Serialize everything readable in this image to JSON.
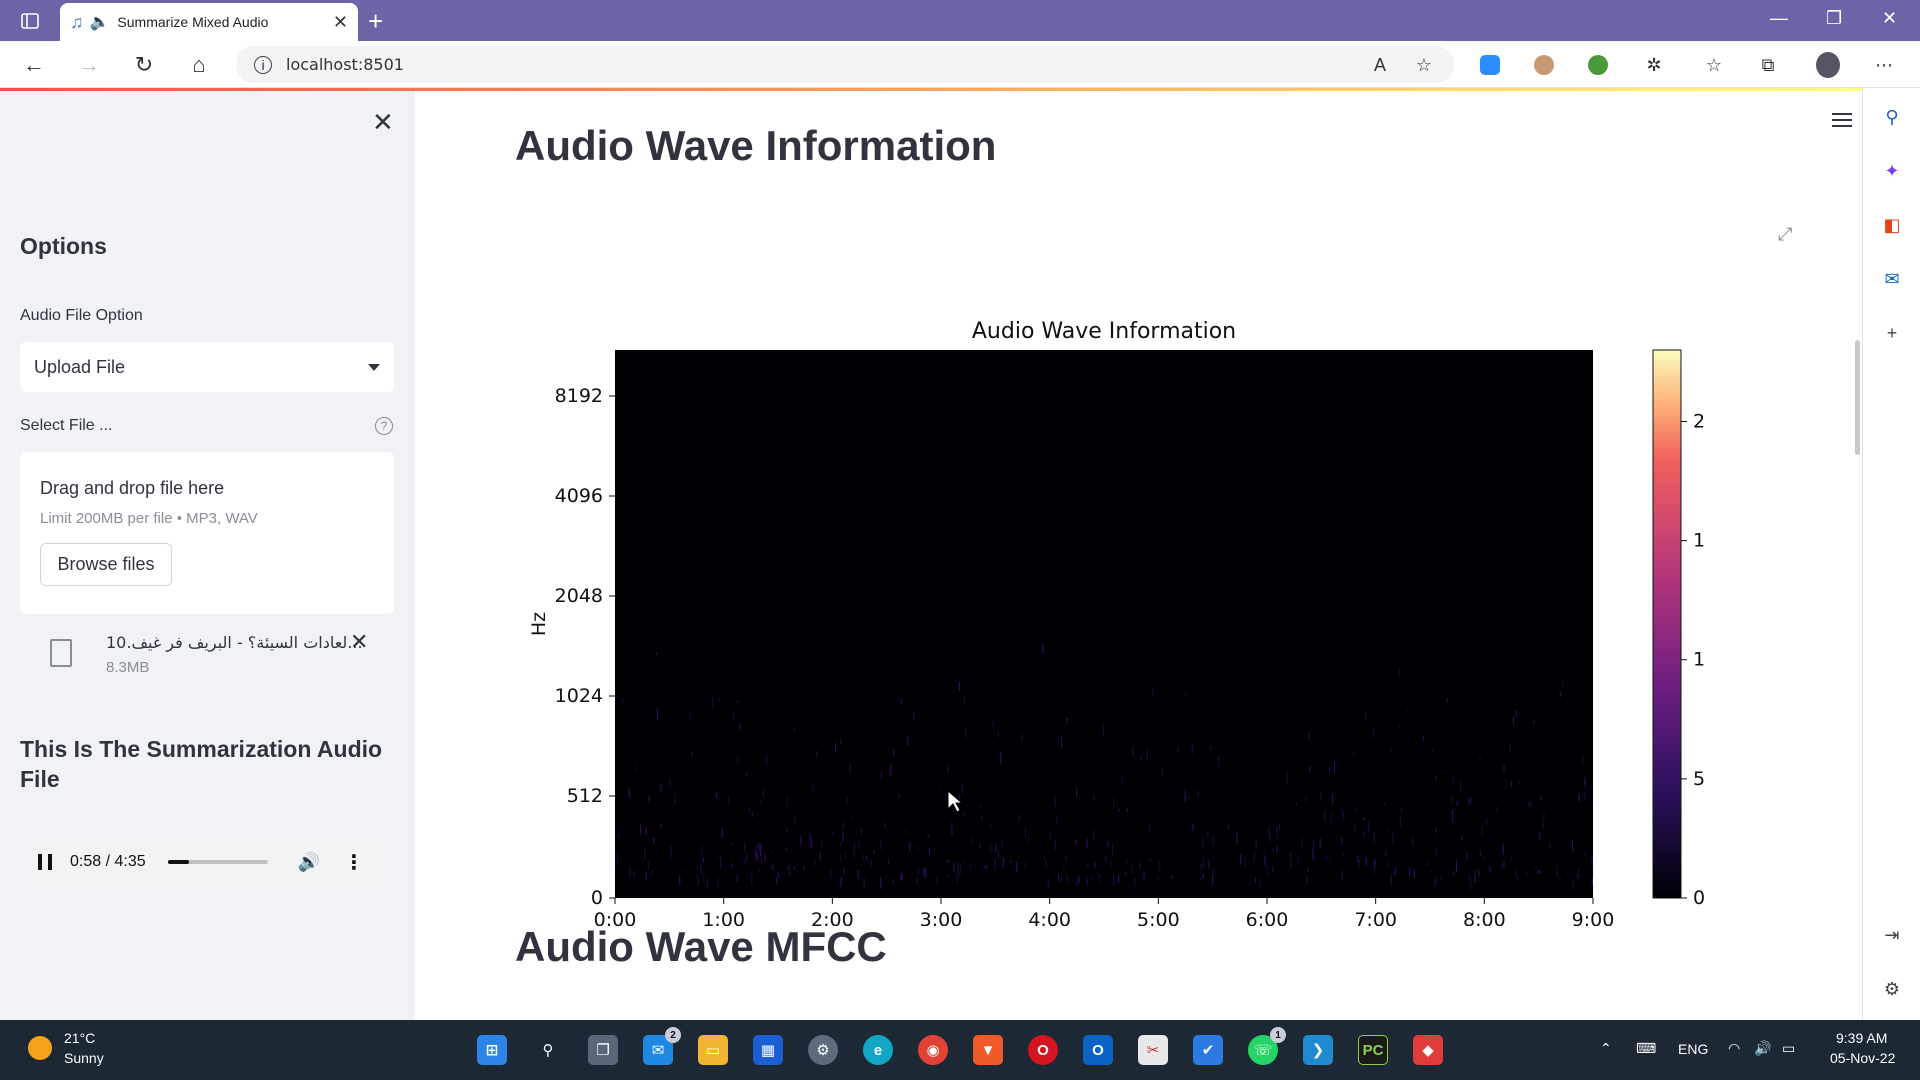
{
  "browser": {
    "tab_title": "Summarize Mixed Audio",
    "url": "localhost:8501"
  },
  "sidebar": {
    "heading": "Options",
    "audio_option_label": "Audio File Option",
    "audio_option_value": "Upload File",
    "select_file_label": "Select File ...",
    "dropzone_title": "Drag and drop file here",
    "dropzone_limit": "Limit 200MB per file • MP3, WAV",
    "browse_label": "Browse files",
    "file_name": "10.لعادات السيئة؟ - البريف فر غيف...",
    "file_size": "8.3MB",
    "summary_heading": "This Is The Summarization Audio File",
    "player_time": "0:58 / 4:35",
    "player_progress": 0.21
  },
  "main": {
    "heading_top": "Audio Wave Information",
    "heading_bottom": "Audio Wave MFCC"
  },
  "chart_data": {
    "type": "heatmap",
    "title": "Audio Wave Information",
    "xlabel": "Time",
    "ylabel": "Hz",
    "x_ticks": [
      "0:00",
      "1:00",
      "2:00",
      "3:00",
      "4:00",
      "5:00",
      "6:00",
      "7:00",
      "8:00",
      "9:00"
    ],
    "y_ticks": [
      "0",
      "512",
      "1024",
      "2048",
      "4096",
      "8192"
    ],
    "colorbar_ticks": [
      "0",
      "500",
      "1000",
      "1500",
      "2000"
    ],
    "colorbar_range": [
      0,
      2300
    ],
    "colormap": "magma",
    "xlim": [
      "0:00",
      "9:00"
    ]
  },
  "taskbar": {
    "temp": "21°C",
    "condition": "Sunny",
    "lang": "ENG",
    "time": "9:39 AM",
    "date": "05-Nov-22",
    "badge_mail": "2",
    "badge_whatsapp": "1"
  }
}
